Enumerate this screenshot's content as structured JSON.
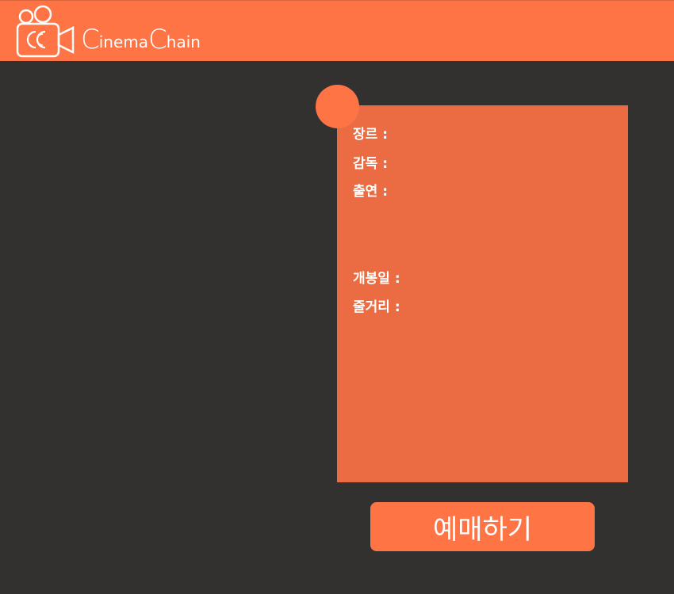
{
  "header": {
    "brand_c1": "C",
    "brand_part1": "inema",
    "brand_c2": "C",
    "brand_part2": "hain"
  },
  "movie_info": {
    "genre_label": "장르 :",
    "genre_value": "",
    "director_label": "감독 :",
    "director_value": "",
    "cast_label": "출연 :",
    "cast_value": "",
    "release_label": "개봉일 :",
    "release_value": "",
    "synopsis_label": "줄거리 :",
    "synopsis_value": ""
  },
  "actions": {
    "book_label": "예매하기"
  },
  "colors": {
    "header": "#ff7444",
    "background": "#323130",
    "panel": "#eb6c42",
    "accent": "#ff7444"
  }
}
